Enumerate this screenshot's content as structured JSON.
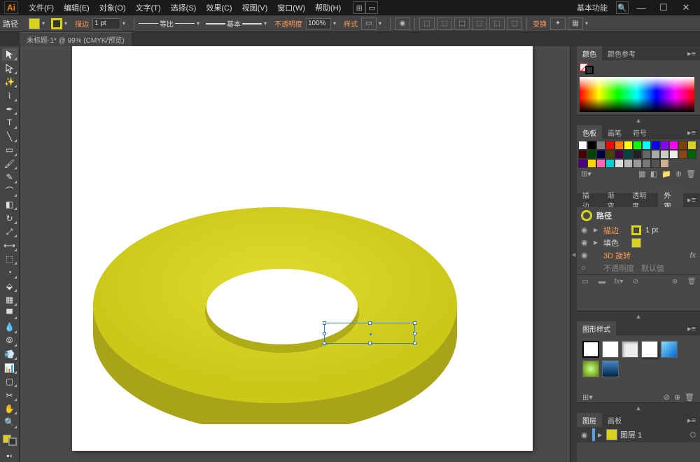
{
  "title": {
    "workspace": "基本功能"
  },
  "menu": [
    "文件(F)",
    "编辑(E)",
    "对象(O)",
    "文字(T)",
    "选择(S)",
    "效果(C)",
    "视图(V)",
    "窗口(W)",
    "帮助(H)"
  ],
  "control": {
    "pathLabel": "路径",
    "fill": "#d9d21a",
    "stroke": "#d9d21a",
    "strokeLabel": "描边",
    "strokeWeight": "1 pt",
    "dashLabel": "等比",
    "profileLabel": "基本",
    "opacityLabel": "不透明度",
    "opacity": "100%",
    "styleLabel": "样式",
    "transformLabel": "变换"
  },
  "doc": {
    "tab": "未标题-1* @ 99% (CMYK/预览)"
  },
  "panels": {
    "colorTabs": [
      "颜色",
      "颜色参考"
    ],
    "swatchTabs": [
      "色板",
      "画笔",
      "符号"
    ],
    "appTabs": [
      "描边",
      "渐变",
      "透明度",
      "外观"
    ],
    "appearance": {
      "title": "路径",
      "rows": [
        {
          "label": "描边",
          "val": "1 pt",
          "hl": true
        },
        {
          "label": "填色",
          "val": "",
          "hl": false
        },
        {
          "label": "3D 旋转",
          "val": "",
          "hl": true,
          "fx": true
        },
        {
          "label": "不透明度",
          "val": "默认值",
          "hl": false,
          "dim": true
        }
      ]
    },
    "gsTab": "图形样式",
    "layerTabs": [
      "图层",
      "画板"
    ],
    "layer": {
      "name": "图层 1"
    }
  },
  "swatches": [
    "#fff",
    "#000",
    "#808080",
    "#f00",
    "#ff8000",
    "#ff0",
    "#0f0",
    "#0ff",
    "#00f",
    "#80f",
    "#f0f",
    "#804000",
    "#d9d21a",
    "#400",
    "#040",
    "#004",
    "#440",
    "#404",
    "#044",
    "#222",
    "#666",
    "#aaa",
    "#ccc",
    "#eee",
    "#8b4513",
    "#006400",
    "#4b0082",
    "#ffd700",
    "#ff69b4",
    "#00ced1",
    "#ddd",
    "#bbb",
    "#999",
    "#777",
    "#555",
    "#ccb090"
  ]
}
